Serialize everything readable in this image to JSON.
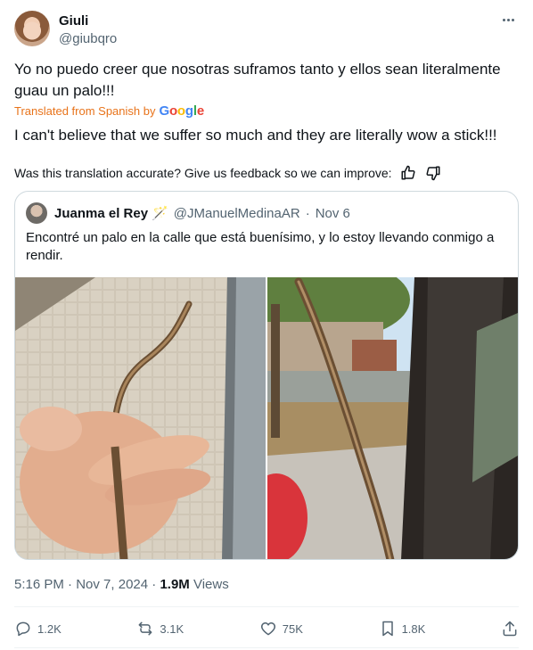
{
  "author": {
    "display_name": "Giuli",
    "handle": "@giubqro"
  },
  "tweet": {
    "text": "Yo no puedo creer que nosotras suframos tanto y ellos sean literalmente guau un palo!!!",
    "translated_label": "Translated from Spanish by",
    "translated_provider": "Google",
    "translation": "I can't believe that we suffer so much and they are literally wow a stick!!!",
    "feedback_prompt": "Was this translation accurate? Give us feedback so we can improve:"
  },
  "quote": {
    "display_name": "Juanma el Rey",
    "emoji": "🪄",
    "handle": "@JManuelMedinaAR",
    "separator": "·",
    "date": "Nov 6",
    "text": "Encontré un palo en la calle que está buenísimo, y lo estoy llevando conmigo a rendir."
  },
  "meta": {
    "time": "5:16 PM",
    "separator": "·",
    "date": "Nov 7, 2024",
    "separator2": "·",
    "views_count": "1.9M",
    "views_label": "Views"
  },
  "actions": {
    "replies": "1.2K",
    "reposts": "3.1K",
    "likes": "75K",
    "bookmarks": "1.8K"
  },
  "icons": [
    "more-icon",
    "thumbs-up-icon",
    "thumbs-down-icon",
    "reply-icon",
    "repost-icon",
    "like-icon",
    "bookmark-icon",
    "share-icon"
  ],
  "colors": {
    "text": "#0f1419",
    "secondary": "#536471",
    "translated": "#e8731a",
    "border": "#cfd9de"
  }
}
